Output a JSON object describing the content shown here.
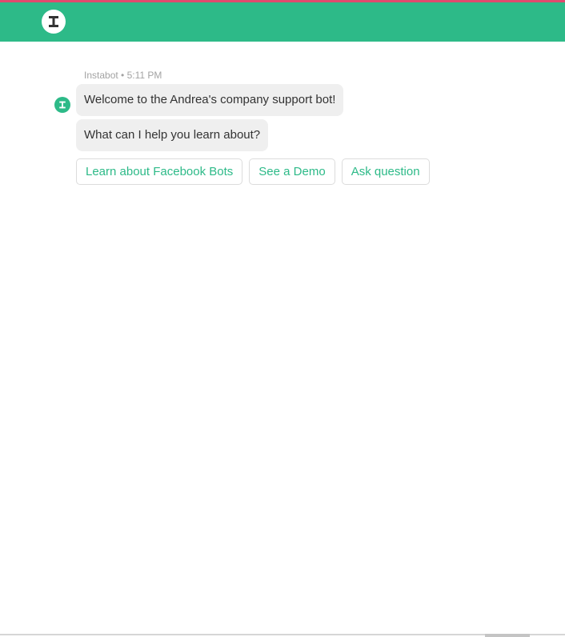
{
  "colors": {
    "accent": "#2dba88",
    "top_stripe": "#e04a6e",
    "bubble_bg": "#efefef",
    "meta_text": "#a3a3a3"
  },
  "header": {
    "logo_icon": "instabot-logo-icon"
  },
  "conversation": {
    "sender": "Instabot",
    "time": "5:11 PM",
    "meta": "Instabot • 5:11 PM",
    "avatar_icon": "instabot-avatar-icon",
    "messages": [
      "Welcome to the Andrea's company support bot!",
      "What can I help you learn about?"
    ],
    "quick_replies": [
      "Learn about Facebook Bots",
      "See a Demo",
      "Ask question"
    ]
  }
}
